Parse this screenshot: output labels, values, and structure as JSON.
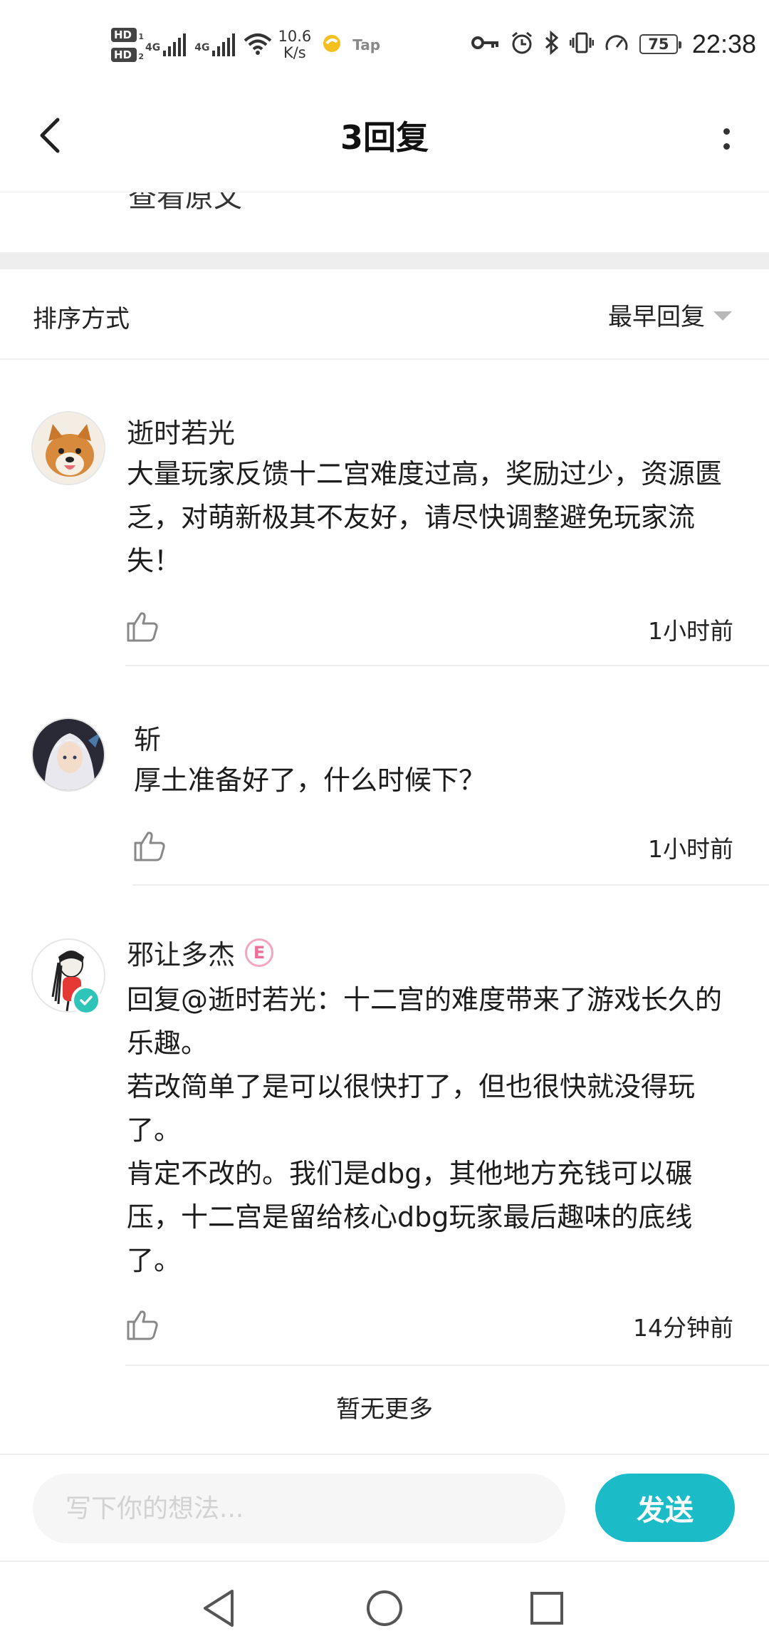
{
  "status_bar": {
    "hd1": "HD",
    "hd1_sub": "1",
    "hd2": "HD",
    "hd2_sub": "2",
    "signal1_label": "4G",
    "signal2_label": "4G",
    "speed_value": "10.6",
    "speed_unit": "K/s",
    "app_label": "Tap",
    "battery": "75",
    "time": "22:38"
  },
  "header": {
    "title": "3回复",
    "clipped_text": "查看原文"
  },
  "sort": {
    "label": "排序方式",
    "selected": "最早回复"
  },
  "comments": [
    {
      "name": "逝时若光",
      "body": [
        "大量玩家反馈十二宫难度过高，奖励过少，资源匮乏，对萌新极其不友好，请尽快调整避免玩家流失！"
      ],
      "time": "1小时前",
      "avatar": "shiba-dog-avatar"
    },
    {
      "name": "斩",
      "body": [
        "厚土准备好了，什么时候下？"
      ],
      "time": "1小时前",
      "avatar": "anime-character-avatar"
    },
    {
      "name": "邪让多杰",
      "badge": "E",
      "body": [
        "回复@逝时若光：十二宫的难度带来了游戏长久的乐趣。",
        "若改简单了是可以很快打了，但也很快就没得玩了。",
        "肯定不改的。我们是dbg，其他地方充钱可以碾压，十二宫是留给核心dbg玩家最后趣味的底线了。"
      ],
      "time": "14分钟前",
      "avatar": "cartoon-figure-avatar",
      "verified": true
    }
  ],
  "footer": {
    "no_more": "暂无更多"
  },
  "composer": {
    "placeholder": "写下你的想法...",
    "send": "发送"
  },
  "colors": {
    "accent": "#1bbcc8",
    "divider": "#eeeeee",
    "badge_pink": "#ee6f98"
  }
}
